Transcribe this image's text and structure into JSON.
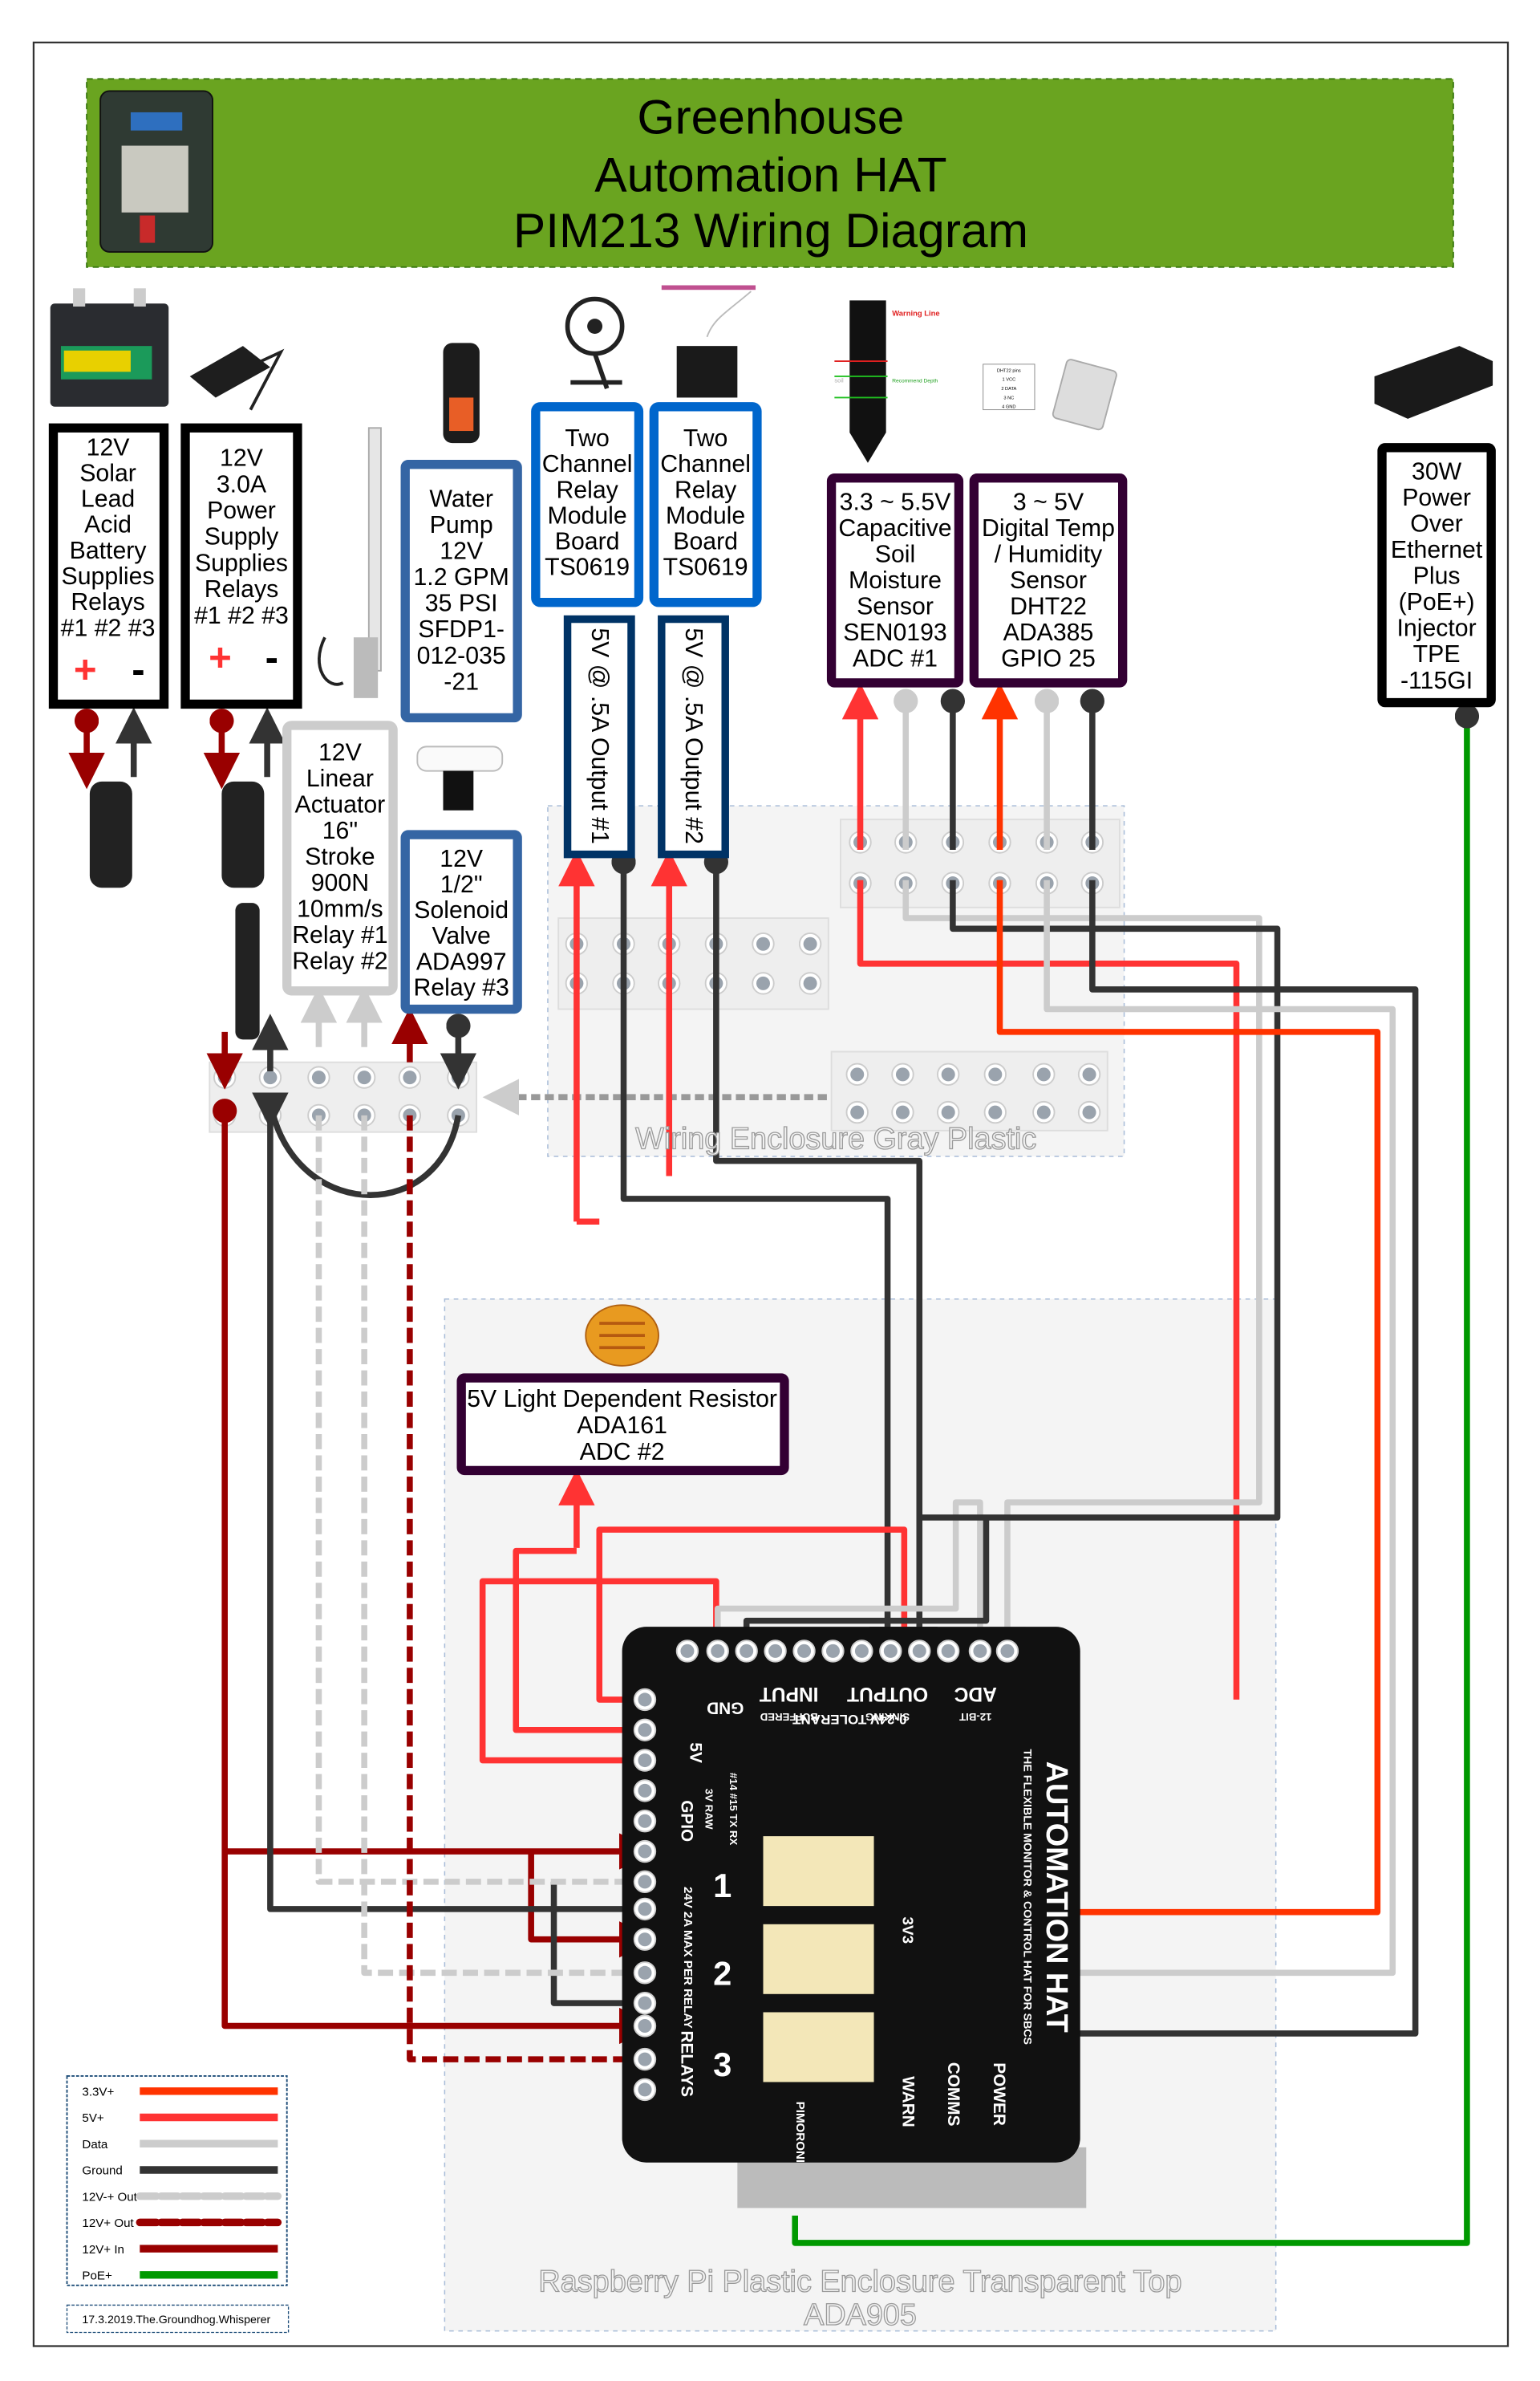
{
  "title": {
    "lines": [
      "Greenhouse",
      "Automation HAT",
      "PIM213 Wiring Diagram"
    ],
    "background": "#6aa420"
  },
  "components": {
    "battery": {
      "lines": [
        "12V",
        "Solar",
        "Lead",
        "Acid",
        "Battery",
        "Supplies",
        "Relays",
        "#1 #2 #3"
      ],
      "plus": "+",
      "minus": "-"
    },
    "power_supply": {
      "lines": [
        "12V",
        "3.0A",
        "Power",
        "Supply",
        "Supplies",
        "Relays",
        "#1 #2 #3"
      ],
      "plus": "+",
      "minus": "-"
    },
    "linear_actuator": {
      "lines": [
        "12V",
        "Linear",
        "Actuator",
        "16\"",
        "Stroke",
        "900N",
        "10mm/s",
        "Relay #1",
        "Relay #2"
      ]
    },
    "water_pump": {
      "lines": [
        "Water",
        "Pump",
        "12V",
        "1.2 GPM",
        "35 PSI",
        "SFDP1-",
        "012-035",
        "-21"
      ]
    },
    "relay_module_1": {
      "lines": [
        "Two",
        "Channel",
        "Relay",
        "Module",
        "Board",
        "TS0619"
      ]
    },
    "relay_module_2": {
      "lines": [
        "Two",
        "Channel",
        "Relay",
        "Module",
        "Board",
        "TS0619"
      ]
    },
    "output_1": {
      "label": "5V @ .5A Output #1"
    },
    "output_2": {
      "label": "5V @ .5A Output #2"
    },
    "solenoid_valve": {
      "lines": [
        "12V",
        "1/2\"",
        "Solenoid",
        "Valve",
        "ADA997",
        "Relay #3"
      ]
    },
    "soil_sensor": {
      "lines": [
        "3.3 ~ 5.5V",
        "Capacitive",
        "Soil",
        "Moisture",
        "Sensor",
        "SEN0193",
        "ADC #1"
      ],
      "image_text": [
        "Warning Line",
        "Recommend Depth",
        "soil"
      ]
    },
    "dht22": {
      "lines": [
        "3 ~ 5V",
        "Digital Temp",
        "/ Humidity",
        "Sensor",
        "DHT22",
        "ADA385",
        "GPIO 25"
      ],
      "pin_table": [
        "DHT22 pins",
        "1 VCC",
        "2 DATA",
        "3 NC",
        "4 GND"
      ]
    },
    "poe_injector": {
      "lines": [
        "30W",
        "Power",
        "Over",
        "Ethernet",
        "Plus",
        "(PoE+)",
        "Injector",
        "TPE",
        "-115GI"
      ]
    },
    "ldr": {
      "lines": [
        "5V Light Dependent Resistor",
        "ADA161",
        "ADC #2"
      ]
    }
  },
  "enclosures": {
    "wiring": "Wiring Enclosure Gray Plastic",
    "pi_line1": "Raspberry Pi Plastic Enclosure Transparent Top",
    "pi_line2": "ADA905"
  },
  "hat": {
    "labels": [
      "GND",
      "5V",
      "INPUT",
      "BUFFERED",
      "OUTPUT",
      "SINKING",
      "ADC",
      "12-BIT",
      "0-24V TOLERANT",
      "GPIO",
      "3V RAW",
      "#14 #15 TX RX",
      "24V 2A MAX PER RELAY",
      "RELAYS",
      "WARN",
      "COMMS",
      "POWER",
      "3V3",
      "AUTOMATION HAT",
      "THE FLEXIBLE MONITOR & CONTROL HAT FOR SBCS",
      "PIMORONI"
    ],
    "relay_numbers": [
      "1",
      "2",
      "3"
    ]
  },
  "legend": {
    "items": [
      {
        "label": "3.3V+",
        "color": "#ff3300",
        "style": "solid"
      },
      {
        "label": "5V+",
        "color": "#ff3333",
        "style": "solid"
      },
      {
        "label": "Data",
        "color": "#cccccc",
        "style": "solid"
      },
      {
        "label": "Ground",
        "color": "#333333",
        "style": "solid"
      },
      {
        "label": "12V-+ Out",
        "color": "#cccccc",
        "style": "dashed"
      },
      {
        "label": "12V+ Out",
        "color": "#990000",
        "style": "dashed"
      },
      {
        "label": "12V+ In",
        "color": "#990000",
        "style": "solid"
      },
      {
        "label": "PoE+",
        "color": "#009900",
        "style": "solid"
      }
    ]
  },
  "credit": "17.3.2019.The.Groundhog.Whisperer"
}
